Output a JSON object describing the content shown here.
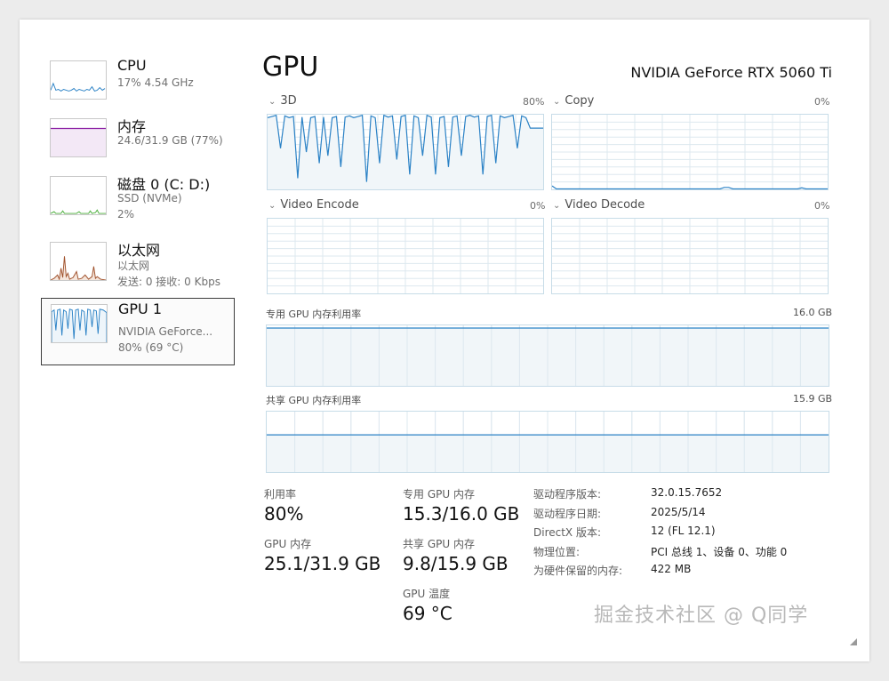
{
  "sidebar": {
    "items": [
      {
        "title": "CPU",
        "line1": "17% 4.54 GHz",
        "line2": "",
        "line3": "",
        "color": "#2b82c6"
      },
      {
        "title": "内存",
        "line1": "24.6/31.9 GB (77%)",
        "line2": "",
        "line3": "",
        "color": "#8b1fa3"
      },
      {
        "title": "磁盘 0 (C: D:)",
        "line1": "SSD (NVMe)",
        "line2": "2%",
        "line3": "",
        "color": "#4caf3d"
      },
      {
        "title": "以太网",
        "line1": "以太网",
        "line2": "发送: 0 接收: 0 Kbps",
        "line3": "",
        "color": "#a0522d"
      },
      {
        "title": "GPU 1",
        "line1": "NVIDIA GeForce...",
        "line2": "80% (69 °C)",
        "line3": "",
        "color": "#2b82c6"
      }
    ]
  },
  "header": {
    "title": "GPU",
    "device": "NVIDIA GeForce RTX 5060 Ti"
  },
  "engines": [
    {
      "label": "3D",
      "value": "80%"
    },
    {
      "label": "Copy",
      "value": "0%"
    },
    {
      "label": "Video Encode",
      "value": "0%"
    },
    {
      "label": "Video Decode",
      "value": "0%"
    }
  ],
  "memory_graphs": {
    "dedicated_label": "专用 GPU 内存利用率",
    "dedicated_max": "16.0 GB",
    "shared_label": "共享 GPU 内存利用率",
    "shared_max": "15.9 GB"
  },
  "stats": {
    "utilization_label": "利用率",
    "utilization_value": "80%",
    "dedicated_label": "专用 GPU 内存",
    "dedicated_value": "15.3/16.0 GB",
    "gpu_memory_label": "GPU 内存",
    "gpu_memory_value": "25.1/31.9 GB",
    "shared_label": "共享 GPU 内存",
    "shared_value": "9.8/15.9 GB",
    "temp_label": "GPU 温度",
    "temp_value": "69 °C"
  },
  "info": [
    {
      "key": "驱动程序版本:",
      "value": "32.0.15.7652"
    },
    {
      "key": "驱动程序日期:",
      "value": "2025/5/14"
    },
    {
      "key": "DirectX 版本:",
      "value": "12 (FL 12.1)"
    },
    {
      "key": "物理位置:",
      "value": "PCI 总线 1、设备 0、功能 0"
    },
    {
      "key": "为硬件保留的内存:",
      "value": "422 MB"
    }
  ],
  "watermark": "掘金技术社区 @ Q同学",
  "colors": {
    "accent": "#2b82c6",
    "graph_border": "#c7dce8",
    "grid": "#dde8ef",
    "fill": "#f1f6f9"
  },
  "levels": {
    "utilization_3d": 0.8,
    "dedicated_mem": 0.956,
    "shared_mem": 0.616
  }
}
